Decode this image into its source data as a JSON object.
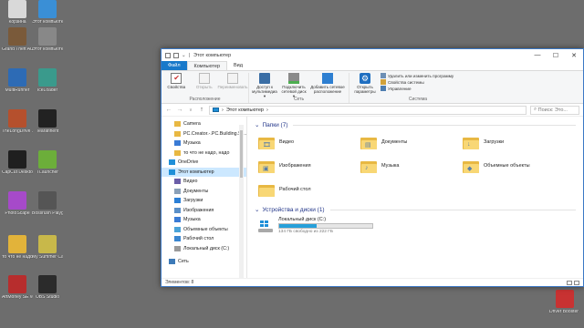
{
  "desktop": {
    "icons": [
      {
        "label": "Корзина",
        "color": "#d9d9d9"
      },
      {
        "label": "Этот компьютер",
        "color": "#3a8fd6"
      },
      {
        "label": "Grand Theft Auto San...",
        "color": "#7a5a3a"
      },
      {
        "label": "Этот компьютер",
        "color": "#888888"
      },
      {
        "label": "MultiRunner",
        "color": "#2d6bb5"
      },
      {
        "label": "IceLoader",
        "color": "#3a9a8c"
      },
      {
        "label": "TheLongDrive ...egally",
        "color": "#b5502d"
      },
      {
        "label": "Tearafinent",
        "color": "#222222"
      },
      {
        "label": "CapCut Desktop",
        "color": "#1f1f1f"
      },
      {
        "label": "TLauncher",
        "color": "#6cae3a"
      },
      {
        "label": "PhotoScape",
        "color": "#a64ac9"
      },
      {
        "label": "Bossrush Playground",
        "color": "#555555"
      },
      {
        "label": "то что не надо",
        "color": "#e2b33a"
      },
      {
        "label": "My Summer Car",
        "color": "#c8b84a"
      },
      {
        "label": "ArtMoney SE v8.0",
        "color": "#b72d2d"
      },
      {
        "label": "OBS Studio",
        "color": "#2b2b2b"
      },
      {
        "label": "Driver Booster 10",
        "color": "#c83232"
      }
    ]
  },
  "window": {
    "title": "Этот компьютер",
    "controls": {
      "minimize": "—",
      "maximize": "☐",
      "close": "✕"
    },
    "ribbon_tabs": [
      "Файл",
      "Компьютер",
      "Вид"
    ],
    "ribbon": {
      "groups": [
        {
          "name": "Расположение",
          "buttons": [
            "Свойства",
            "Открыть",
            "Переименовать"
          ]
        },
        {
          "name": "Сеть",
          "buttons": [
            "Доступ к мультимедиа ▾",
            "Подключить сетевой диск ▾",
            "Добавить сетевое расположение"
          ]
        },
        {
          "name": "Система",
          "buttons": [
            "Открыть параметры"
          ],
          "small_buttons": [
            "Удалить или изменить программу",
            "Свойства системы",
            "Управление"
          ]
        }
      ]
    },
    "nav": {
      "back": "←",
      "forward": "→",
      "recent": "∨",
      "up": "↑",
      "address": "Этот компьютер",
      "address_sep": "›",
      "search_placeholder": "Поиск: Это..."
    },
    "nav_pane": [
      {
        "label": "Camera",
        "sub": true,
        "icon": "folder-icon"
      },
      {
        "label": "PC.Creator.-.PC.Building.Si...",
        "sub": true,
        "icon": "folder-icon"
      },
      {
        "label": "Музыка",
        "sub": true,
        "icon": "music-icon"
      },
      {
        "label": "то что не надо, надо",
        "sub": true,
        "icon": "folder-icon"
      },
      {
        "label": "OneDrive",
        "sub": false,
        "icon": "cloud-icon"
      },
      {
        "label": "Этот компьютер",
        "sub": false,
        "icon": "computer-icon",
        "selected": true
      },
      {
        "label": "Видео",
        "sub": true,
        "icon": "video-icon"
      },
      {
        "label": "Документы",
        "sub": true,
        "icon": "documents-icon"
      },
      {
        "label": "Загрузки",
        "sub": true,
        "icon": "download-icon"
      },
      {
        "label": "Изображения",
        "sub": true,
        "icon": "pictures-icon"
      },
      {
        "label": "Музыка",
        "sub": true,
        "icon": "music-icon"
      },
      {
        "label": "Объемные объекты",
        "sub": true,
        "icon": "3d-objects-icon"
      },
      {
        "label": "Рабочий стол",
        "sub": true,
        "icon": "desktop-icon"
      },
      {
        "label": "Локальный диск (C:)",
        "sub": true,
        "icon": "drive-icon"
      },
      {
        "label": "Сеть",
        "sub": false,
        "icon": "network-icon",
        "gap": true
      }
    ],
    "folders_header": "Папки (7)",
    "folders": [
      {
        "label": "Видео",
        "glyph": "🎞"
      },
      {
        "label": "Документы",
        "glyph": "▤"
      },
      {
        "label": "Загрузки",
        "glyph": "↓"
      },
      {
        "label": "Изображения",
        "glyph": "▣"
      },
      {
        "label": "Музыка",
        "glyph": "♪"
      },
      {
        "label": "Объемные объекты",
        "glyph": "◆"
      },
      {
        "label": "Рабочий стол",
        "glyph": ""
      }
    ],
    "drives_header": "Устройства и диски (1)",
    "drives": [
      {
        "label": "Локальный диск (C:)",
        "free": "134 ГБ свободно из 222 ГБ",
        "used_fraction": 0.4
      }
    ],
    "status": "Элементов: 8"
  }
}
